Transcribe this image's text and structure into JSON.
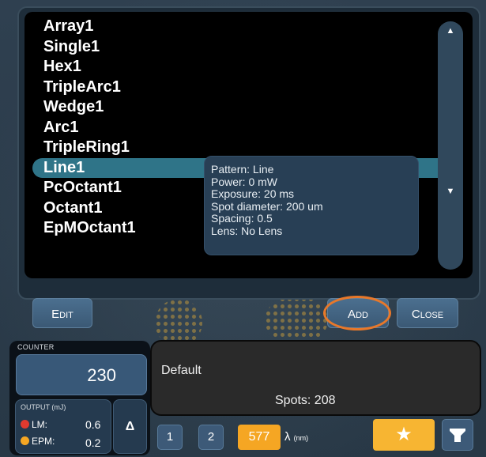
{
  "pattern_list": {
    "items": [
      "Array1",
      "Single1",
      "Hex1",
      "TripleArc1",
      "Wedge1",
      "Arc1",
      "TripleRing1",
      "Line1",
      "PcOctant1",
      "Octant1",
      "EpMOctant1"
    ],
    "selected_index": 7
  },
  "tooltip": {
    "pattern": "Pattern: Line",
    "power": "Power: 0 mW",
    "exposure": "Exposure: 20 ms",
    "spot_diameter": "Spot diameter: 200 um",
    "spacing": "Spacing: 0.5",
    "lens": "Lens: No Lens"
  },
  "scrollbar": {
    "up_icon": "triangle-up-icon",
    "down_icon": "triangle-down-icon"
  },
  "buttons": {
    "edit": {
      "first": "E",
      "rest": "DIT"
    },
    "add": {
      "first": "A",
      "rest": "DD"
    },
    "close": {
      "first": "C",
      "rest": "LOSE"
    }
  },
  "counter": {
    "label": "COUNTER",
    "value": "230"
  },
  "output": {
    "label": "OUTPUT (mJ)",
    "lm_label": "LM:",
    "lm_value": "0.6",
    "lm_color": "#e03a2f",
    "epm_label": "EPM:",
    "epm_value": "0.2",
    "epm_color": "#f5a623"
  },
  "delta_label": "Δ",
  "info": {
    "title": "Default",
    "spots": "Spots: 208"
  },
  "bottom_bar": {
    "btn1": "1",
    "btn2": "2",
    "wavelength": "577",
    "lambda": "λ",
    "lambda_unit": "(nm)",
    "star_icon": "star-icon",
    "filter_icon": "filter-icon"
  },
  "colors": {
    "accent": "#f5a623",
    "highlight": "#e8782a",
    "selection": "#2f7488"
  }
}
